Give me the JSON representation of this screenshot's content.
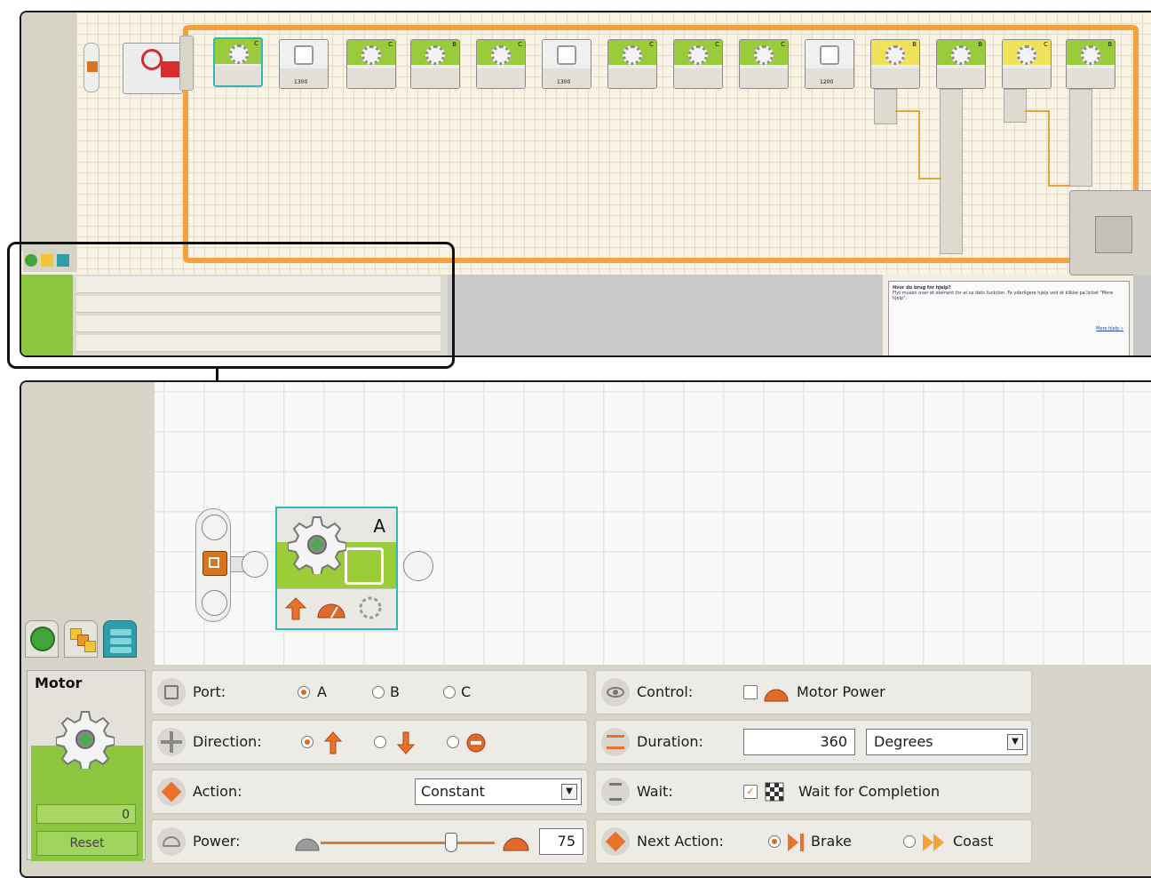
{
  "zoom": {
    "motor_block": {
      "port": "A"
    },
    "config": {
      "block_title": "Motor",
      "counter": "0",
      "reset_label": "Reset",
      "port": {
        "label": "Port:",
        "options": [
          "A",
          "B",
          "C"
        ],
        "selected": "A"
      },
      "direction": {
        "label": "Direction:",
        "selected": "forward"
      },
      "action": {
        "label": "Action:",
        "value": "Constant"
      },
      "power": {
        "label": "Power:",
        "value": "75",
        "level_percent": 75
      },
      "control": {
        "label": "Control:",
        "option": "Motor Power",
        "checked": false
      },
      "duration": {
        "label": "Duration:",
        "value": "360",
        "unit": "Degrees"
      },
      "wait": {
        "label": "Wait:",
        "option": "Wait for Completion",
        "checked": true
      },
      "next_action": {
        "label": "Next Action:",
        "options": [
          "Brake",
          "Coast"
        ],
        "selected": "Brake"
      }
    }
  },
  "mini": {
    "block_ports": [
      "C",
      "C",
      "B",
      "C",
      "C",
      "C",
      "C",
      "B",
      "B",
      "C",
      "B"
    ],
    "wait_values": [
      "1300",
      "1300",
      "1200"
    ],
    "help_title": "Hvor du brug for hjelp?",
    "help_text": "Flyt musen over et element for at se dets funktion. Fa yderligere hjelp ved at klikke pa linket \"Mere hjelp\".",
    "help_link": "Mere hjelp »"
  },
  "colors": {
    "accent_green": "#8cc63f",
    "loop_orange": "#f3a23c",
    "select_teal": "#2fb8b4",
    "arrow_orange": "#e06a1e"
  }
}
